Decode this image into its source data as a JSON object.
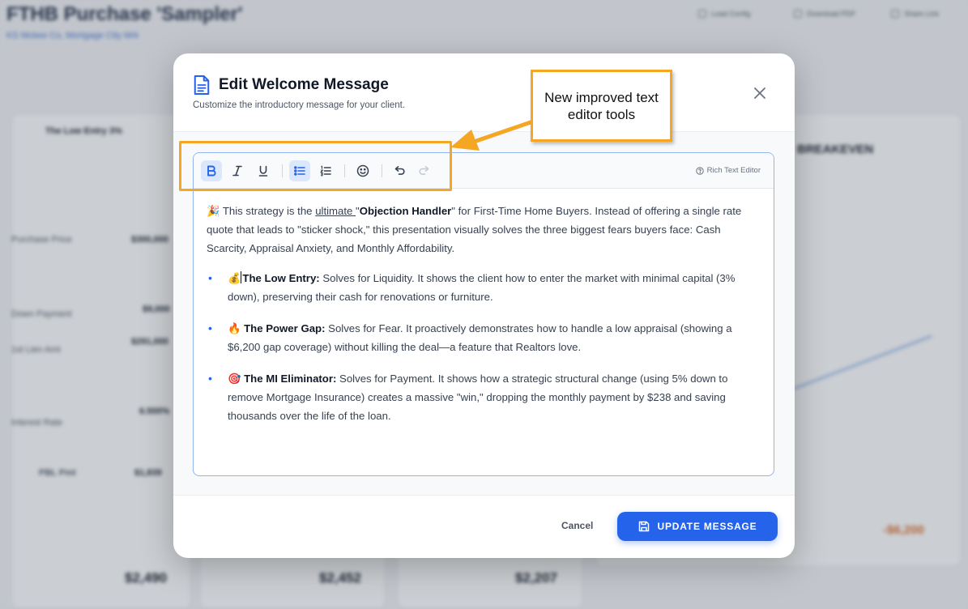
{
  "background": {
    "title": "FTHB Purchase 'Sampler'",
    "subtitle": "KS Mckee Co, Mortgage City Mrk",
    "top_buttons": [
      "Load Config",
      "Download PDF",
      "Share Link"
    ],
    "panel_left_title": "The Low Entry 3%",
    "rows": [
      {
        "label": "Purchase Price",
        "value": "$300,000"
      },
      {
        "label": "Down Payment",
        "value": "$9,000"
      },
      {
        "label": "1st Lien Amt",
        "value": "$291,000"
      },
      {
        "label": "Interest Rate",
        "value": "6.500%"
      }
    ],
    "piti_label": "PBL Pmt",
    "piti_value": "$1,839",
    "totals": [
      "$2,490",
      "$2,452",
      "$2,207"
    ],
    "breakeven": "BREAKEVEN",
    "orange_value": "-$6,200"
  },
  "modal": {
    "title": "Edit Welcome Message",
    "subtitle": "Customize the introductory message for your client.",
    "rich_text_label": "Rich Text Editor",
    "intro": {
      "emoji": "🎉",
      "before": " This strategy is the ",
      "underlined": "ultimate ",
      "quote_open": "\"",
      "bold": "Objection Handler",
      "after": "\" for First-Time Home Buyers. Instead of offering a single rate quote that leads to \"sticker shock,\" this presentation visually solves the three biggest fears buyers face: Cash Scarcity, Appraisal Anxiety, and Monthly Affordability."
    },
    "bullets": [
      {
        "emoji": "💰",
        "bold": "The Low Entry:",
        "text": " Solves for Liquidity. It shows the client how to enter the market with minimal capital (3% down), preserving their cash for renovations or furniture."
      },
      {
        "emoji": "🔥",
        "bold": "The Power Gap:",
        "text": " Solves for Fear. It proactively demonstrates how to handle a low appraisal (showing a $6,200 gap coverage) without killing the deal—a feature that Realtors love."
      },
      {
        "emoji": "🎯",
        "bold": "The MI Eliminator:",
        "text": " Solves for Payment. It shows how a strategic structural change (using 5% down to remove Mortgage Insurance) creates a massive \"win,\" dropping the monthly payment by $238 and saving thousands over the life of the loan."
      }
    ],
    "cancel_label": "Cancel",
    "update_label": "UPDATE MESSAGE"
  },
  "annotation": {
    "callout_text": "New improved text editor tools",
    "color": "#f5a623"
  },
  "colors": {
    "accent": "#2563eb",
    "annotation": "#f5a623"
  }
}
